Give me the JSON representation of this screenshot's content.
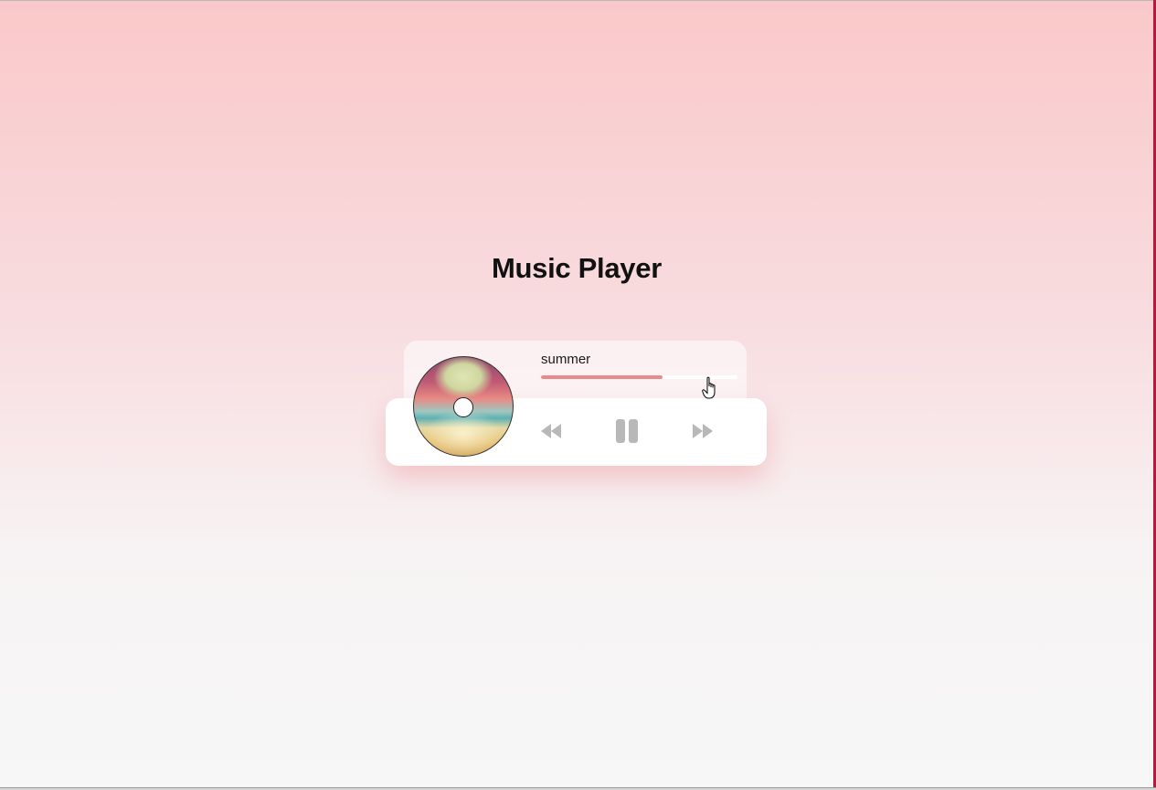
{
  "page": {
    "title": "Music Player",
    "background_top": "#fac8c9",
    "background_bottom": "#f7f7f7"
  },
  "player": {
    "song_title": "summer",
    "progress": 0.62,
    "progress_color": "#ec8a8b",
    "album_art": "beach-sunset-heart-clouds",
    "is_playing": true
  },
  "controls": {
    "prev_icon": "backward-icon",
    "play_pause_icon": "pause-icon",
    "next_icon": "forward-icon",
    "icon_color": "#b8b8b8"
  },
  "cursor": {
    "icon": "hand-pointer-icon"
  }
}
